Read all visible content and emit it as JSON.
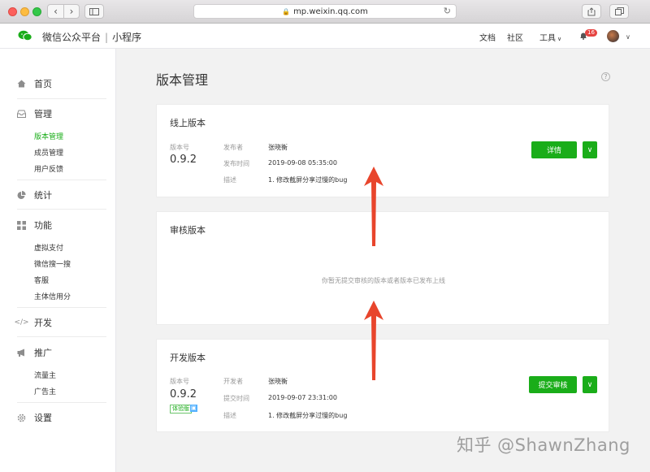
{
  "browser": {
    "url": "mp.weixin.qq.com",
    "back": "‹",
    "forward": "›"
  },
  "header": {
    "brand": "微信公众平台",
    "product": "小程序",
    "links": {
      "docs": "文档",
      "community": "社区",
      "tools": "工具"
    },
    "notification_count": "16"
  },
  "sidebar": {
    "home": "首页",
    "manage": "管理",
    "manage_items": [
      "版本管理",
      "成员管理",
      "用户反馈"
    ],
    "stats": "统计",
    "features": "功能",
    "feature_items": [
      "虚拟支付",
      "微信搜一搜",
      "客服",
      "主体信用分"
    ],
    "develop": "开发",
    "promote": "推广",
    "promote_items": [
      "流量主",
      "广告主"
    ],
    "settings": "设置"
  },
  "main": {
    "title": "版本管理",
    "online": {
      "title": "线上版本",
      "version_label": "版本号",
      "version": "0.9.2",
      "publisher_label": "发布者",
      "publisher": "张晓衡",
      "time_label": "发布时间",
      "time": "2019-09-08 05:35:00",
      "desc_label": "描述",
      "desc": "1. 修改截屏分享过慢的bug",
      "action": "详情"
    },
    "review": {
      "title": "审核版本",
      "empty": "你暂无提交审核的版本或者版本已发布上线"
    },
    "dev": {
      "title": "开发版本",
      "version_label": "版本号",
      "version": "0.9.2",
      "tag": "体验版",
      "developer_label": "开发者",
      "developer": "张晓衡",
      "time_label": "提交时间",
      "time": "2019-09-07 23:31:00",
      "desc_label": "描述",
      "desc": "1. 修改截屏分享过慢的bug",
      "action": "提交审核"
    }
  },
  "watermark": "知乎 @ShawnZhang",
  "colors": {
    "brand_green": "#1aad19",
    "arrow_red": "#e8452c",
    "badge_red": "#e64340"
  }
}
